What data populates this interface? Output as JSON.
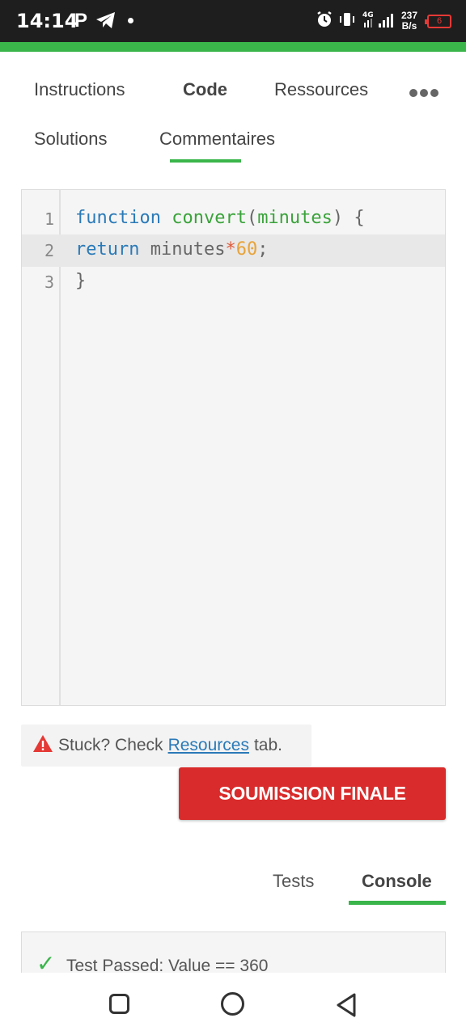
{
  "status_bar": {
    "time": "14:14",
    "p_indicator": "P",
    "speed_value": "237",
    "speed_unit": "B/s",
    "network": "4G",
    "battery": "6"
  },
  "tabs": {
    "instructions": "Instructions",
    "code": "Code",
    "resources": "Ressources",
    "solutions": "Solutions",
    "comments": "Commentaires",
    "active": "Commentaires"
  },
  "editor": {
    "lines": [
      {
        "number": "1",
        "tokens": [
          [
            "kw",
            "function"
          ],
          [
            "plain",
            " "
          ],
          [
            "fn",
            "convert"
          ],
          [
            "plain",
            "("
          ],
          [
            "fn",
            "minutes"
          ],
          [
            "plain",
            ") {"
          ]
        ]
      },
      {
        "number": "2",
        "tokens": [
          [
            "kw",
            "return"
          ],
          [
            "plain",
            " minutes"
          ],
          [
            "op",
            "*"
          ],
          [
            "num",
            "60"
          ],
          [
            "plain",
            ";"
          ]
        ]
      },
      {
        "number": "3",
        "tokens": [
          [
            "plain",
            "}"
          ]
        ]
      }
    ]
  },
  "hint": {
    "prefix": "Stuck? Check",
    "link": "Resources",
    "suffix": "tab."
  },
  "submit_label": "SOUMISSION FINALE",
  "bottom_tabs": {
    "tests": "Tests",
    "console": "Console",
    "active": "Console"
  },
  "result": {
    "text": "Test Passed: Value == 360"
  },
  "colors": {
    "accent_green": "#3ab54a",
    "submit_red": "#d92b2b",
    "link_blue": "#2a7ab8"
  }
}
